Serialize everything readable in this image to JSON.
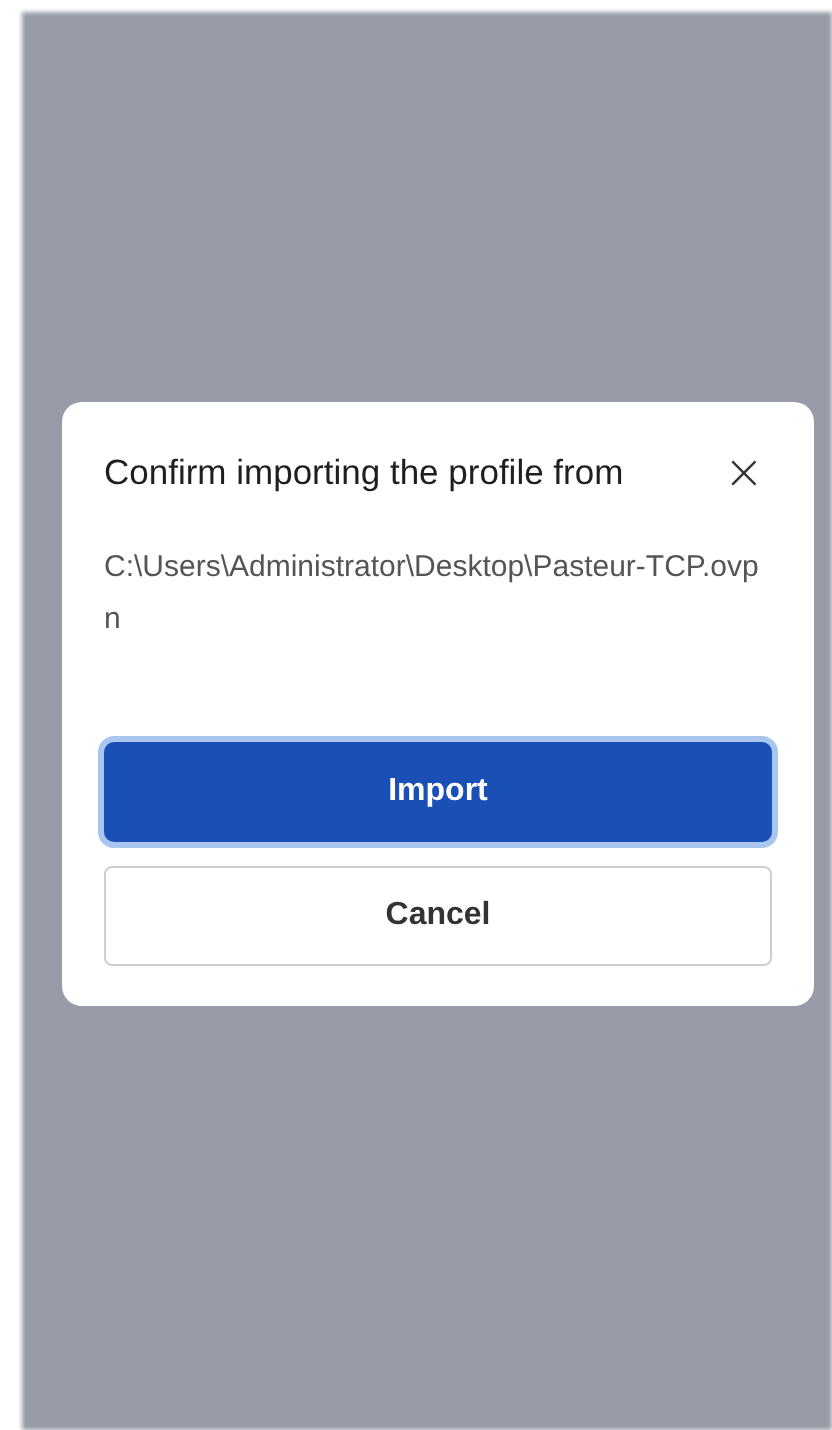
{
  "dialog": {
    "title": "Confirm importing the profile from",
    "close": "×",
    "path": "C:\\Users\\Administrator\\Desktop\\Pasteur-TCP.ovpn",
    "buttons": [
      {
        "label": "Import",
        "kind": "primary"
      },
      {
        "label": "Cancel",
        "kind": "secondary"
      }
    ]
  }
}
